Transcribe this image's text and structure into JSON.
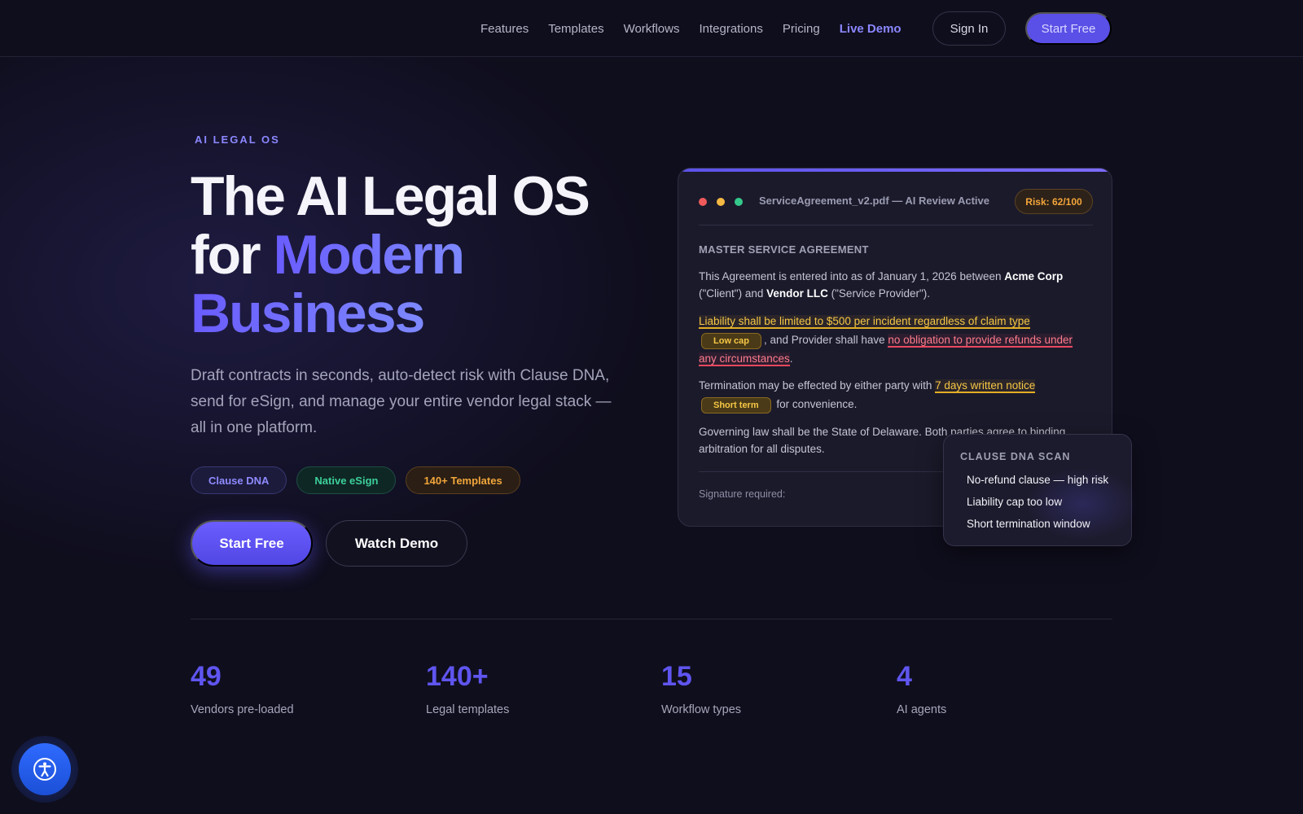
{
  "nav": {
    "links": [
      {
        "label": "Features"
      },
      {
        "label": "Templates"
      },
      {
        "label": "Workflows"
      },
      {
        "label": "Integrations"
      },
      {
        "label": "Pricing"
      },
      {
        "label": "Live Demo",
        "active": true
      }
    ],
    "signin_label": "Sign In",
    "start_label": "Start Free"
  },
  "hero": {
    "eyebrow": "AI LEGAL OS",
    "title_line1": "The AI Legal OS",
    "title_for": "for ",
    "title_grad1": "Modern",
    "title_grad2": "Business",
    "subtitle": "Draft contracts in seconds, auto-detect risk with Clause DNA, send for eSign, and manage your entire vendor legal stack — all in one platform.",
    "pills": [
      "Clause DNA",
      "Native eSign",
      "140+ Templates"
    ],
    "start_label": "Start Free",
    "watch_label": "Watch Demo"
  },
  "card": {
    "title": "ServiceAgreement_v2.pdf — AI Review Active",
    "risk": "Risk: 62/100",
    "doc_heading": "MASTER SERVICE AGREEMENT",
    "p1_a": "This Agreement is entered into as of January 1, 2026 between ",
    "p1_party1": "Acme Corp",
    "p1_b": " (\"Client\") and ",
    "p1_party2": "Vendor LLC",
    "p1_c": " (\"Service Provider\").",
    "p2_hl1": "Liability shall be limited to $500 per incident regardless of claim type",
    "p2_tag": "Low cap",
    "p2_mid": ", and Provider shall have ",
    "p2_hl2": "no obligation to provide refunds under any circumstances",
    "p2_end": ".",
    "p3_a": "Termination may be effected by either party with ",
    "p3_hl": "7 days written notice",
    "p3_tag": "Short term",
    "p3_end": " for convenience.",
    "p4": "Governing law shall be the State of Delaware. Both parties agree to binding arbitration for all disputes.",
    "signature": "Signature required:"
  },
  "scan": {
    "title": "CLAUSE DNA SCAN",
    "items": [
      "No-refund clause — high risk",
      "Liability cap too low",
      "Short termination window"
    ]
  },
  "stats": [
    {
      "num": "49",
      "label": "Vendors pre-loaded"
    },
    {
      "num": "140+",
      "label": "Legal templates"
    },
    {
      "num": "15",
      "label": "Workflow types"
    },
    {
      "num": "4",
      "label": "AI agents"
    }
  ],
  "colors": {
    "accent": "#5a4fe6",
    "accent_light": "#8b87ff",
    "risk_amber": "#f3a53a",
    "risk_red": "#e9485e",
    "green": "#3ccf9a",
    "dot_red": "#f05a5a",
    "dot_yellow": "#f4b942",
    "dot_green": "#34c98b"
  },
  "icons": {
    "accessibility": "accessibility-icon"
  }
}
